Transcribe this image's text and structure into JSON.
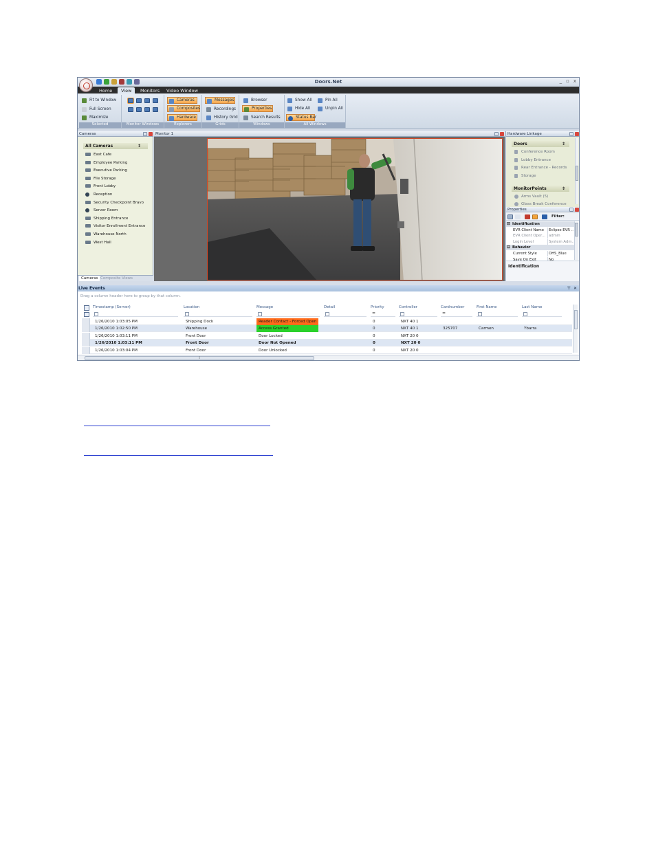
{
  "app": {
    "title": "Doors.Net",
    "window_controls": [
      "_",
      "▫",
      "x"
    ]
  },
  "tabs": [
    "Home",
    "View",
    "Monitors",
    "Video Window"
  ],
  "ribbon": {
    "selected": {
      "title": "Selected",
      "buttons": [
        "Fit to Window",
        "Full Screen",
        "Maximize"
      ]
    },
    "monitor_windows": {
      "title": "Monitor Windows"
    },
    "explorers": {
      "title": "Explorers",
      "buttons": [
        "Cameras",
        "Composites",
        "Hardware"
      ]
    },
    "grids": {
      "title": "Grids",
      "buttons": [
        "Messages",
        "Recordings",
        "History Grid"
      ]
    },
    "windows": {
      "title": "Windows",
      "buttons": [
        "Browser",
        "Properties",
        "Search Results"
      ]
    },
    "all_windows": {
      "title": "All Windows",
      "buttons": [
        "Show All",
        "Hide All",
        "Status Bar",
        "Pin All",
        "Unpin All"
      ]
    }
  },
  "cameras_panel": {
    "title": "Cameras",
    "group": "All Cameras",
    "items": [
      "East Cafe",
      "Employee Parking",
      "Executive Parking",
      "File Storage",
      "Front Lobby",
      "Reception",
      "Security Checkpoint Bravo",
      "Server Room",
      "Shipping Entrance",
      "Visitor Enrollment Entrance",
      "Warehouse North",
      "West Hall"
    ],
    "tabs": [
      "Cameras",
      "Composite Views"
    ]
  },
  "monitor": {
    "title": "Monitor 1"
  },
  "hardware_panel": {
    "title": "Hardware Linkage",
    "doors_label": "Doors",
    "doors": [
      "Conference Room",
      "Lobby Entrance",
      "Rear Entrance - Records",
      "Storage"
    ],
    "monitor_points_label": "MonitorPoints",
    "monitor_points": [
      "Arms Vault (5)",
      "Glass Break Conference"
    ]
  },
  "properties_panel": {
    "title": "Properties",
    "filter_label": "Filter:",
    "rows": [
      {
        "type": "cat",
        "k": "Identification",
        "v": ""
      },
      {
        "type": "row",
        "k": "EVR Client Name",
        "v": "Eclipse EVR ..."
      },
      {
        "type": "dim",
        "k": "EVR Client Oper...",
        "v": "admin"
      },
      {
        "type": "dim",
        "k": "Login Level",
        "v": "System Adm..."
      },
      {
        "type": "cat",
        "k": "Behavior",
        "v": ""
      },
      {
        "type": "row",
        "k": "Current Style",
        "v": "DHS_Blue"
      },
      {
        "type": "row",
        "k": "Save On Exit",
        "v": "No"
      },
      {
        "type": "dim",
        "k": "Selected Mon...",
        "v": "1"
      }
    ],
    "description": "Identification"
  },
  "events": {
    "title": "Live Events",
    "group_hint": "Drag a column header here to group by that column.",
    "columns": [
      "Timestamp (Server)",
      "Location",
      "Message",
      "Detail",
      "Priority",
      "Controller",
      "Cardnumber",
      "First Name",
      "Last Name"
    ],
    "rows": [
      {
        "ts": "1/26/2010 1:03:05 PM",
        "loc": "Shipping Dock",
        "msg": "Reader Contact - Forced Open",
        "detail": "",
        "pri": "0",
        "ctrl": "NXT 40 1",
        "card": "",
        "first": "",
        "last": "",
        "msg_color": "#ff6a1a",
        "bold": false,
        "sel": false
      },
      {
        "ts": "1/26/2010 1:02:50 PM",
        "loc": "Warehouse",
        "msg": "Access Granted",
        "detail": "",
        "pri": "0",
        "ctrl": "NXT 40 1",
        "card": "325707",
        "first": "Carmen",
        "last": "Ybarra",
        "msg_color": "#2bd12b",
        "bold": false,
        "sel": true
      },
      {
        "ts": "1/26/2010 1:03:11 PM",
        "loc": "Front Door",
        "msg": "Door Locked",
        "detail": "",
        "pri": "0",
        "ctrl": "NXT 20 0",
        "card": "",
        "first": "",
        "last": "",
        "msg_color": "",
        "bold": false,
        "sel": false
      },
      {
        "ts": "1/26/2010 1:03:11 PM",
        "loc": "Front Door",
        "msg": "Door Not Opened",
        "detail": "",
        "pri": "0",
        "ctrl": "NXT 20 0",
        "card": "",
        "first": "",
        "last": "",
        "msg_color": "",
        "bold": true,
        "sel": true
      },
      {
        "ts": "1/26/2010 1:03:04 PM",
        "loc": "Front Door",
        "msg": "Door Unlocked",
        "detail": "",
        "pri": "0",
        "ctrl": "NXT 20 0",
        "card": "",
        "first": "",
        "last": "",
        "msg_color": "",
        "bold": false,
        "sel": false
      }
    ]
  },
  "colors": {
    "accent_orange": "#f7a64a",
    "tab_bar": "#2d2d2d",
    "link": "#2b3fd0"
  }
}
